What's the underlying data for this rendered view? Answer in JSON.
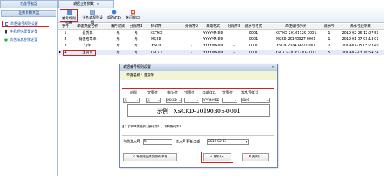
{
  "left_nav": {
    "tab_title": "功能导航器",
    "header": "业务参数类型",
    "items": [
      {
        "label": "单据编号规则设置",
        "icon": "doc-icon"
      },
      {
        "label": "手机短信配置设置",
        "icon": "phone-icon"
      },
      {
        "label": "微信消息参数设置",
        "icon": "wechat-icon"
      }
    ]
  },
  "top_tab": {
    "title": "单据业务参数",
    "close": "×"
  },
  "toolbar": {
    "buttons": [
      {
        "label": "编号规则设置",
        "icon": "settings-icon"
      },
      {
        "label": "业务单规则设置",
        "icon": "rules-icon"
      },
      {
        "label": "帮助(F1)",
        "icon": "help-icon"
      },
      {
        "label": "关闭窗口",
        "icon": "close-window-icon"
      }
    ]
  },
  "grid": {
    "columns": [
      "序号",
      "单据类型名称",
      "编号前缀",
      "分隔符1",
      "标识符",
      "分隔符2",
      "日期格式",
      "分隔符3",
      "流水号格式",
      "单据编号示例",
      "流水号",
      "流水号更新日"
    ],
    "rows": [
      [
        "1",
        "退货单",
        "无",
        "无",
        "XSTHD",
        "-",
        "YYYYMMDD",
        "-",
        "0001",
        "XSTHD-20161129-0001",
        "1",
        "2019-02-26 12:07:53"
      ],
      [
        "2",
        "销售结算单",
        "无",
        "无",
        "XSJSD",
        "-",
        "YYYYMMDD",
        "-",
        "0001",
        "XSJSD-20140927-0001",
        "1",
        "2019-01-07 03:13:01"
      ],
      [
        "3",
        "订单",
        "无",
        "无",
        "XSDD",
        "-",
        "YYYYMMDD",
        "-",
        "0001",
        "XSDD-20140927-0001",
        "2",
        "2019-01-05 05:23:49"
      ],
      [
        "4",
        "送货单",
        "无",
        "无",
        "XSCKD",
        "-",
        "YYYYMMDD",
        "-",
        "0001",
        "XSCKD-20161201-0001",
        "5",
        "2019-02-13 16:54:34"
      ]
    ]
  },
  "dialog": {
    "title": "单据编号规则设置",
    "close": "×",
    "subtitle": "单据名称：送货单",
    "format_headers": [
      "前缀",
      "分隔符",
      "标识符",
      "分隔符",
      "日期样式",
      "分隔符",
      "流水号样式"
    ],
    "format_values": [
      "无",
      "无",
      "XSCKD",
      "-",
      "YYYYMMDD",
      "-",
      "0001"
    ],
    "example": "示例　XSCKD-20190305-0001",
    "note": "注：示例中数据部门编码为01，机构编码为1",
    "current_serial_label": "当前流水号",
    "current_serial_value": "5",
    "update_date_label": "流水号更新日期",
    "update_date_value": "2019-02-13",
    "apply_all_button": "将规则应用到所有单据",
    "save_button": "保存(S)",
    "close_button": "关闭(C)"
  },
  "colors": {
    "highlight": "#d42222",
    "accent_blue": "#1d56a8",
    "title_bar": "#c6d7ee"
  }
}
